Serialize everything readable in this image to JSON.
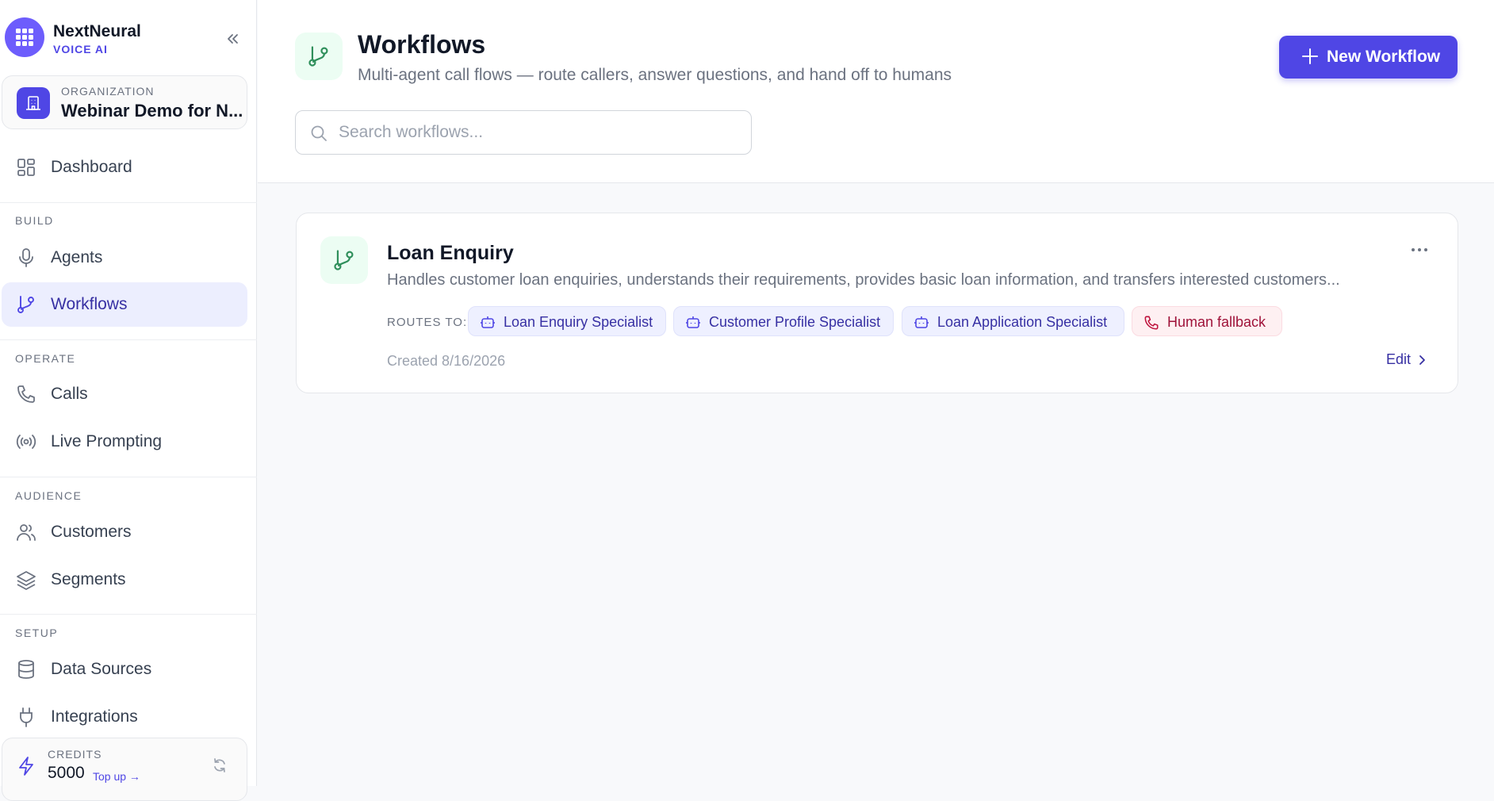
{
  "brand": {
    "name": "NextNeural",
    "sub": "VOICE AI"
  },
  "organization": {
    "label": "ORGANIZATION",
    "name": "Webinar Demo for N..."
  },
  "nav": {
    "dashboard": "Dashboard",
    "sections": {
      "build": "BUILD",
      "operate": "OPERATE",
      "audience": "AUDIENCE",
      "setup": "SETUP"
    },
    "agents": "Agents",
    "workflows": "Workflows",
    "calls": "Calls",
    "live_prompting": "Live Prompting",
    "customers": "Customers",
    "segments": "Segments",
    "data_sources": "Data Sources",
    "integrations": "Integrations",
    "active_item": "Workflows"
  },
  "credits": {
    "label": "CREDITS",
    "value": "5000",
    "topup": "Top up →"
  },
  "header": {
    "title": "Workflows",
    "subtitle": "Multi-agent call flows — route callers, answer questions, and hand off to humans",
    "new_button": "New Workflow",
    "search_placeholder": "Search workflows..."
  },
  "workflows": [
    {
      "title": "Loan Enquiry",
      "description": "Handles customer loan enquiries, understands their requirements, provides basic loan information, and transfers interested customers...",
      "routes_label": "ROUTES TO:",
      "routes": [
        {
          "label": "Loan Enquiry Specialist",
          "kind": "agent"
        },
        {
          "label": "Customer Profile Specialist",
          "kind": "agent"
        },
        {
          "label": "Loan Application Specialist",
          "kind": "agent"
        },
        {
          "label": "Human fallback",
          "kind": "human"
        }
      ],
      "created": "Created 8/16/2026",
      "edit": "Edit"
    }
  ],
  "colors": {
    "accent": "#4f46e5",
    "green_icon": "#2f8f5b",
    "human_chip": "#9f1239"
  }
}
